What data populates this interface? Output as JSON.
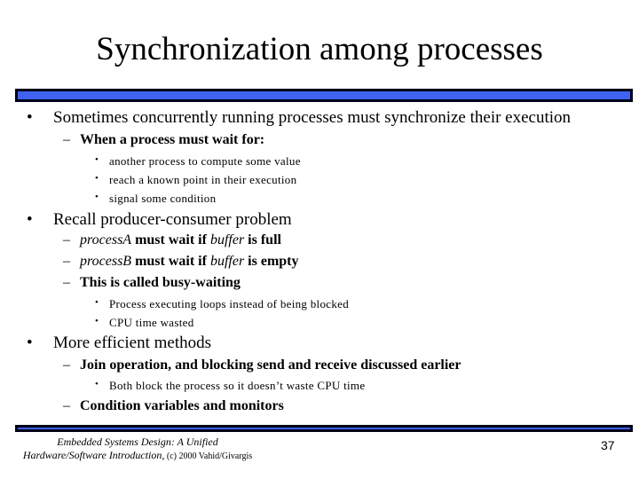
{
  "slide": {
    "title": "Synchronization among processes",
    "accent_color": "#3f63f0",
    "items": [
      {
        "level": 1,
        "text": "Sometimes concurrently running processes must synchronize their execution"
      },
      {
        "level": 2,
        "text": "When a process must wait for:"
      },
      {
        "level": 3,
        "text": "another process to compute some value"
      },
      {
        "level": 3,
        "text": "reach a known point in their execution"
      },
      {
        "level": 3,
        "text": "signal some condition"
      },
      {
        "level": 1,
        "text": "Recall producer-consumer problem"
      },
      {
        "level": 2,
        "italic_a": "processA",
        "text_a": " must wait if ",
        "italic_b": "buffer",
        "text_b": " is full"
      },
      {
        "level": 2,
        "italic_a": "processB",
        "text_a": " must wait if ",
        "italic_b": "buffer",
        "text_b": " is empty"
      },
      {
        "level": 2,
        "text": "This is called busy-waiting"
      },
      {
        "level": 3,
        "text": "Process executing loops instead of being blocked"
      },
      {
        "level": 3,
        "text": "CPU time wasted"
      },
      {
        "level": 1,
        "text": "More efficient methods"
      },
      {
        "level": 2,
        "text": "Join operation, and blocking send and receive discussed earlier"
      },
      {
        "level": 3,
        "text": "Both block the process so it doesn’t waste CPU time"
      },
      {
        "level": 2,
        "text": "Condition variables and monitors"
      }
    ],
    "bullet_marks": {
      "level1": "•",
      "level2": "–",
      "level3": "•"
    }
  },
  "footer": {
    "line1": "Embedded Systems Design: A Unified",
    "line2_italic": "Hardware/Software Introduction,",
    "line2_plain": " (c) 2000 Vahid/Givargis",
    "page_number": "37"
  }
}
